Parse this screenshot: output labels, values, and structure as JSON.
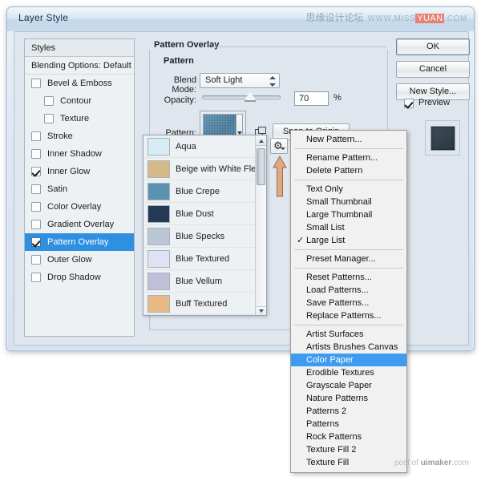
{
  "window": {
    "title": "Layer Style",
    "watermark_top_cn": "思缘设计论坛",
    "watermark_top_www": "WWW.MISS",
    "watermark_top_hl": "YUAN",
    "watermark_top_tail": ".COM",
    "watermark_bottom_pre": "post of ",
    "watermark_bottom_brand": "uimaker",
    "watermark_bottom_post": ".com"
  },
  "styles_panel": {
    "header": "Styles",
    "blending_options": "Blending Options: Default",
    "items": [
      {
        "label": "Bevel & Emboss",
        "checked": false,
        "indent": false,
        "selected": false
      },
      {
        "label": "Contour",
        "checked": false,
        "indent": true,
        "selected": false
      },
      {
        "label": "Texture",
        "checked": false,
        "indent": true,
        "selected": false
      },
      {
        "label": "Stroke",
        "checked": false,
        "indent": false,
        "selected": false
      },
      {
        "label": "Inner Shadow",
        "checked": false,
        "indent": false,
        "selected": false
      },
      {
        "label": "Inner Glow",
        "checked": true,
        "indent": false,
        "selected": false
      },
      {
        "label": "Satin",
        "checked": false,
        "indent": false,
        "selected": false
      },
      {
        "label": "Color Overlay",
        "checked": false,
        "indent": false,
        "selected": false
      },
      {
        "label": "Gradient Overlay",
        "checked": false,
        "indent": false,
        "selected": false
      },
      {
        "label": "Pattern Overlay",
        "checked": true,
        "indent": false,
        "selected": true
      },
      {
        "label": "Outer Glow",
        "checked": false,
        "indent": false,
        "selected": false
      },
      {
        "label": "Drop Shadow",
        "checked": false,
        "indent": false,
        "selected": false
      }
    ]
  },
  "pattern_overlay": {
    "title": "Pattern Overlay",
    "group_label": "Pattern",
    "blend_mode_label": "Blend Mode:",
    "blend_mode_value": "Soft Light",
    "opacity_label": "Opacity:",
    "opacity_value": "70",
    "opacity_unit": "%",
    "pattern_label": "Pattern:",
    "snap_button": "Snap to Origin",
    "pattern_swatch_color": "#4a86a8"
  },
  "pattern_picker": {
    "items": [
      {
        "name": "Aqua",
        "color": "#d7ecf4"
      },
      {
        "name": "Beige with White Flecks",
        "color": "#d6b989"
      },
      {
        "name": "Blue Crepe",
        "color": "#5a92b2"
      },
      {
        "name": "Blue Dust",
        "color": "#223a56"
      },
      {
        "name": "Blue Specks",
        "color": "#bcc7d6"
      },
      {
        "name": "Blue Textured",
        "color": "#dfe2f4"
      },
      {
        "name": "Blue Vellum",
        "color": "#bfbfda"
      },
      {
        "name": "Buff Textured",
        "color": "#e8b985"
      }
    ],
    "selected": "Blue Crepe"
  },
  "gear_menu": {
    "gear_icon": "gear-icon",
    "groups": [
      {
        "items": [
          {
            "label": "New Pattern...",
            "checked": false,
            "selected": false
          }
        ]
      },
      {
        "items": [
          {
            "label": "Rename Pattern...",
            "checked": false,
            "selected": false
          },
          {
            "label": "Delete Pattern",
            "checked": false,
            "selected": false
          }
        ]
      },
      {
        "items": [
          {
            "label": "Text Only",
            "checked": false,
            "selected": false
          },
          {
            "label": "Small Thumbnail",
            "checked": false,
            "selected": false
          },
          {
            "label": "Large Thumbnail",
            "checked": false,
            "selected": false
          },
          {
            "label": "Small List",
            "checked": false,
            "selected": false
          },
          {
            "label": "Large List",
            "checked": true,
            "selected": false
          }
        ]
      },
      {
        "items": [
          {
            "label": "Preset Manager...",
            "checked": false,
            "selected": false
          }
        ]
      },
      {
        "items": [
          {
            "label": "Reset Patterns...",
            "checked": false,
            "selected": false
          },
          {
            "label": "Load Patterns...",
            "checked": false,
            "selected": false
          },
          {
            "label": "Save Patterns...",
            "checked": false,
            "selected": false
          },
          {
            "label": "Replace Patterns...",
            "checked": false,
            "selected": false
          }
        ]
      },
      {
        "items": [
          {
            "label": "Artist Surfaces",
            "checked": false,
            "selected": false
          },
          {
            "label": "Artists Brushes Canvas",
            "checked": false,
            "selected": false
          },
          {
            "label": "Color Paper",
            "checked": false,
            "selected": true
          },
          {
            "label": "Erodible Textures",
            "checked": false,
            "selected": false
          },
          {
            "label": "Grayscale Paper",
            "checked": false,
            "selected": false
          },
          {
            "label": "Nature Patterns",
            "checked": false,
            "selected": false
          },
          {
            "label": "Patterns 2",
            "checked": false,
            "selected": false
          },
          {
            "label": "Patterns",
            "checked": false,
            "selected": false
          },
          {
            "label": "Rock Patterns",
            "checked": false,
            "selected": false
          },
          {
            "label": "Texture Fill 2",
            "checked": false,
            "selected": false
          },
          {
            "label": "Texture Fill",
            "checked": false,
            "selected": false
          }
        ]
      }
    ]
  },
  "buttons": {
    "ok": "OK",
    "cancel": "Cancel",
    "new_style": "New Style...",
    "preview_label": "Preview",
    "preview_checked": true
  },
  "colors": {
    "selection_blue": "#2f8fe0",
    "menu_selection_blue": "#3d9bf0",
    "arrow_orange": "#d2a07a"
  }
}
